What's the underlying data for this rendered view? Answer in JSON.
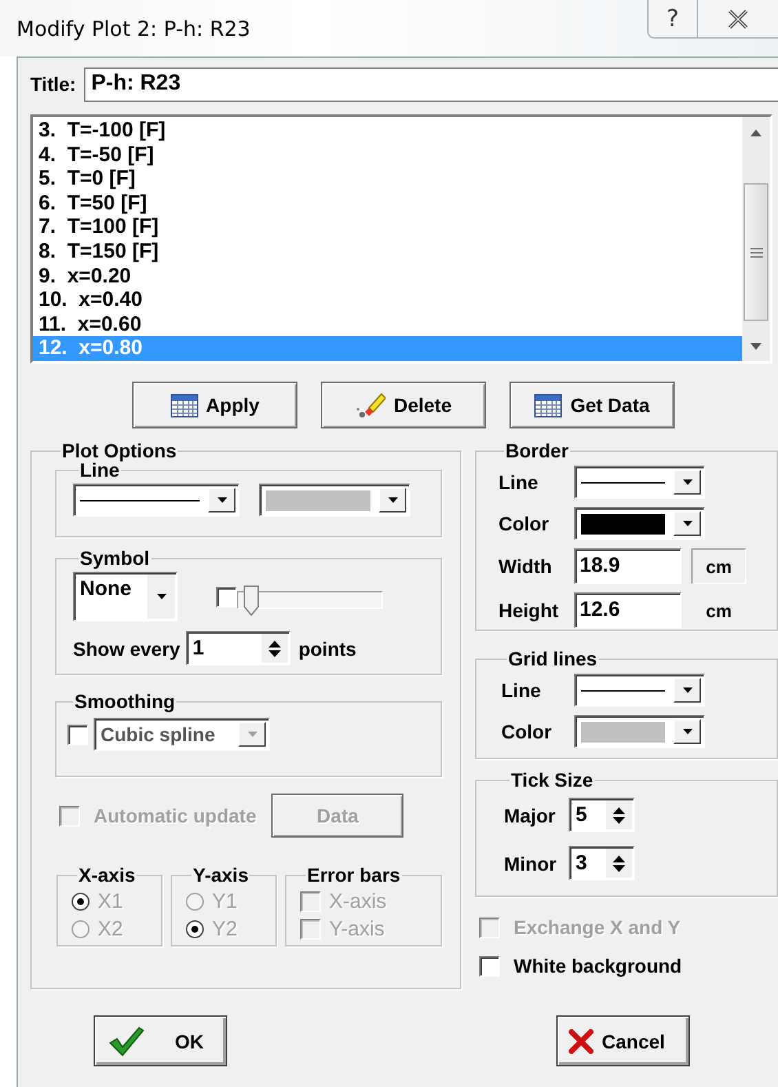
{
  "window": {
    "title": "Modify Plot 2: P-h: R23",
    "help_button": "?"
  },
  "title_field": {
    "label": "Title:",
    "value": "P-h: R23"
  },
  "plot_list": [
    {
      "text": "3.  T=-100 [F]",
      "selected": false
    },
    {
      "text": "4.  T=-50 [F]",
      "selected": false
    },
    {
      "text": "5.  T=0 [F]",
      "selected": false
    },
    {
      "text": "6.  T=50 [F]",
      "selected": false
    },
    {
      "text": "7.  T=100 [F]",
      "selected": false
    },
    {
      "text": "8.  T=150 [F]",
      "selected": false
    },
    {
      "text": "9.  x=0.20",
      "selected": false
    },
    {
      "text": "10.  x=0.40",
      "selected": false
    },
    {
      "text": "11.  x=0.60",
      "selected": false
    },
    {
      "text": "12.  x=0.80",
      "selected": true
    }
  ],
  "action_buttons": [
    {
      "kind": "apply",
      "label": "Apply"
    },
    {
      "kind": "delete",
      "label": "Delete"
    },
    {
      "kind": "data",
      "label": "Get Data"
    }
  ],
  "plot_options": {
    "title": "Plot Options",
    "line": {
      "title": "Line",
      "color": "#c0c0c0"
    },
    "symbol": {
      "title": "Symbol",
      "shape": "None",
      "slider_enabled": {
        "checked": false
      },
      "slider": {
        "level": 0.05
      },
      "show_every": {
        "label": "Show every",
        "value": "1",
        "unit": "points"
      }
    },
    "smoothing": {
      "title": "Smoothing",
      "checked": false,
      "method": "Cubic spline",
      "disabled": true
    },
    "automatic_update": {
      "label": "Automatic update",
      "checked": false,
      "disabled": true
    },
    "data_button": {
      "label": "Data",
      "disabled": true
    },
    "x_axis": {
      "title": "X-axis",
      "options": [
        {
          "label": "X1",
          "selected": true,
          "disabled": true
        },
        {
          "label": "X2",
          "selected": false,
          "disabled": true
        }
      ]
    },
    "y_axis": {
      "title": "Y-axis",
      "options": [
        {
          "label": "Y1",
          "selected": false,
          "disabled": true
        },
        {
          "label": "Y2",
          "selected": true,
          "disabled": true
        }
      ]
    },
    "error_bars": {
      "title": "Error bars",
      "options": [
        {
          "label": "X-axis",
          "checked": false,
          "disabled": true
        },
        {
          "label": "Y-axis",
          "checked": false,
          "disabled": true
        }
      ]
    }
  },
  "border": {
    "title": "Border",
    "line": {
      "label": "Line"
    },
    "color": {
      "label": "Color",
      "color": "#000000"
    },
    "width": {
      "label": "Width",
      "value": "18.9",
      "unit": "cm",
      "unit_framed": true
    },
    "height": {
      "label": "Height",
      "value": "12.6",
      "unit": "cm",
      "unit_framed": false
    }
  },
  "grid_lines": {
    "title": "Grid lines",
    "line": {
      "label": "Line"
    },
    "color": {
      "label": "Color",
      "color": "#c0c0c0"
    }
  },
  "tick_size": {
    "title": "Tick Size",
    "major": {
      "label": "Major",
      "value": "5"
    },
    "minor": {
      "label": "Minor",
      "value": "3"
    }
  },
  "exchange_axes": {
    "label": "Exchange X and Y",
    "checked": false,
    "disabled": true
  },
  "white_background": {
    "label": "White background",
    "checked": false,
    "disabled": false
  },
  "footer_buttons": [
    {
      "kind": "ok",
      "label": "OK"
    },
    {
      "kind": "cancel",
      "label": "Cancel"
    }
  ]
}
